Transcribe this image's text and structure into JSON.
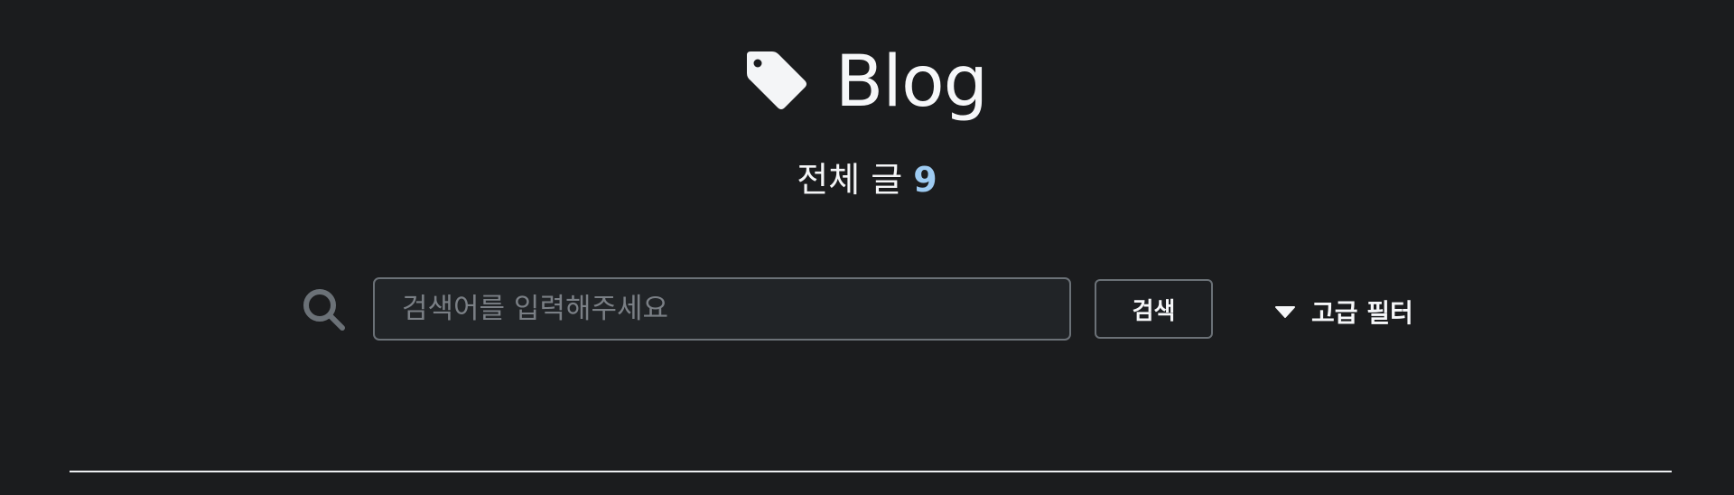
{
  "header": {
    "icon": "tag-icon",
    "title": "Blog"
  },
  "summary": {
    "label": "전체 글",
    "count": "9"
  },
  "search": {
    "icon": "search-icon",
    "placeholder": "검색어를 입력해주세요",
    "value": "",
    "button_label": "검색"
  },
  "filter": {
    "icon": "caret-down-icon",
    "label": "고급 필터"
  },
  "colors": {
    "background": "#1b1c1e",
    "text": "#f4f5f7",
    "accent": "#9ecbf2",
    "input_bg": "#212427",
    "border": "#6b7177"
  }
}
